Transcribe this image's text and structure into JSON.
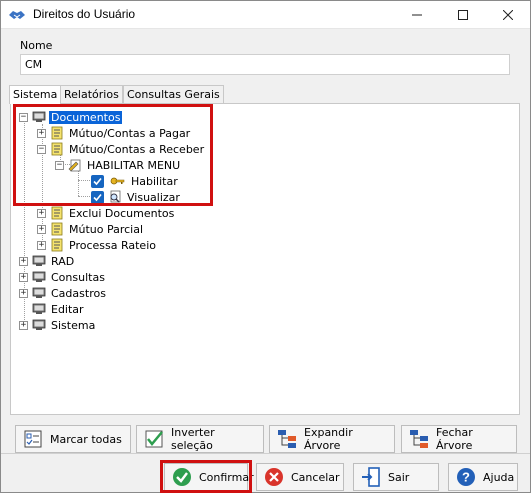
{
  "window": {
    "title": "Direitos do Usuário"
  },
  "name_field": {
    "label": "Nome",
    "value": "CM"
  },
  "tabs": [
    {
      "label": "Sistema",
      "active": true
    },
    {
      "label": "Relatórios",
      "active": false
    },
    {
      "label": "Consultas Gerais",
      "active": false
    }
  ],
  "tree": {
    "documentos": "Documentos",
    "mutuo_pagar": "Mútuo/Contas a Pagar",
    "mutuo_receber": "Mútuo/Contas a Receber",
    "habilitar_menu": "HABILITAR MENU",
    "habilitar": "Habilitar",
    "visualizar": "Visualizar",
    "exclui_documentos": "Exclui Documentos",
    "mutuo_parcial": "Mútuo Parcial",
    "processa_rateio": "Processa Rateio",
    "rad": "RAD",
    "consultas": "Consultas",
    "cadastros": "Cadastros",
    "editar": "Editar",
    "sistema": "Sistema"
  },
  "actions": {
    "marcar_todas": "Marcar todas",
    "inverter_selecao": "Inverter seleção",
    "expandir_arvore": "Expandir Árvore",
    "fechar_arvore": "Fechar Árvore"
  },
  "footer": {
    "confirmar": "Confirmar",
    "cancelar": "Cancelar",
    "sair": "Sair",
    "ajuda": "Ajuda"
  },
  "colors": {
    "selection": "#0a64d8",
    "highlight": "#d01010",
    "confirm": "#2e9e4f",
    "cancel": "#d9342b",
    "help": "#2360b8"
  }
}
